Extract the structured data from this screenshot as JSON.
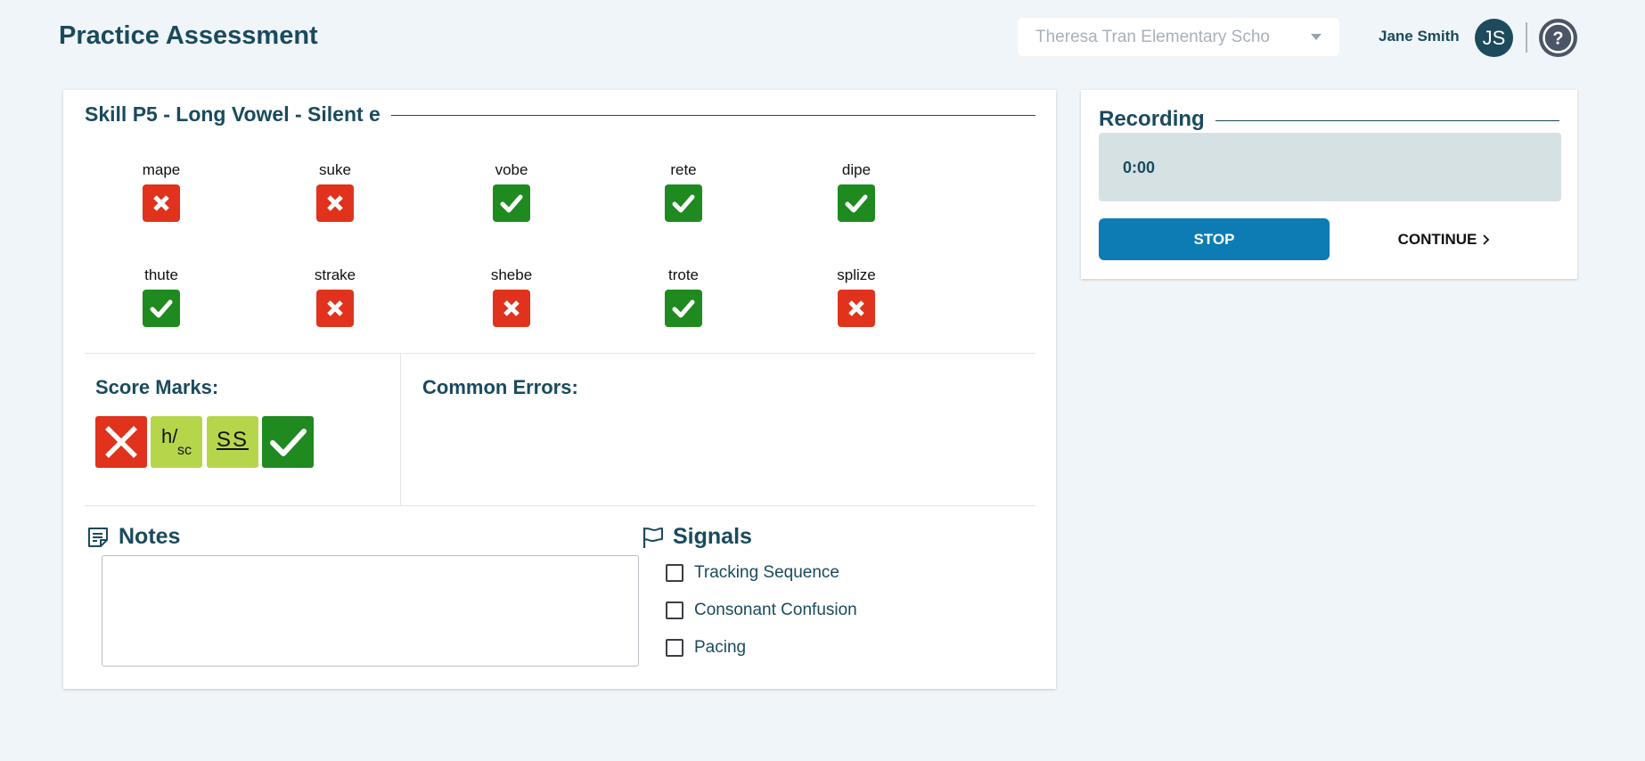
{
  "header": {
    "title": "Practice Assessment",
    "school_selected": "Theresa Tran Elementary Scho",
    "user_name": "Jane Smith",
    "user_initials": "JS",
    "help_symbol": "?"
  },
  "skill": {
    "title": "Skill P5 - Long Vowel - Silent e",
    "words": [
      {
        "word": "mape",
        "mark": "incorrect"
      },
      {
        "word": "suke",
        "mark": "incorrect"
      },
      {
        "word": "vobe",
        "mark": "correct"
      },
      {
        "word": "rete",
        "mark": "correct"
      },
      {
        "word": "dipe",
        "mark": "correct"
      },
      {
        "word": "thute",
        "mark": "correct"
      },
      {
        "word": "strake",
        "mark": "incorrect"
      },
      {
        "word": "shebe",
        "mark": "incorrect"
      },
      {
        "word": "trote",
        "mark": "correct"
      },
      {
        "word": "splize",
        "mark": "incorrect"
      }
    ]
  },
  "score_marks": {
    "label": "Score Marks:",
    "marks": [
      {
        "name": "incorrect",
        "icon": "x-icon"
      },
      {
        "name": "h/sc",
        "text_top": "h/",
        "text_sub": "sc"
      },
      {
        "name": "ss",
        "text": "SS"
      },
      {
        "name": "correct",
        "icon": "check-icon"
      }
    ]
  },
  "common_errors": {
    "label": "Common Errors:"
  },
  "notes": {
    "label": "Notes",
    "value": ""
  },
  "signals": {
    "label": "Signals",
    "items": [
      {
        "label": "Tracking Sequence",
        "checked": false
      },
      {
        "label": "Consonant Confusion",
        "checked": false
      },
      {
        "label": "Pacing",
        "checked": false
      }
    ]
  },
  "recording": {
    "title": "Recording",
    "time": "0:00",
    "stop_label": "STOP",
    "continue_label": "CONTINUE"
  },
  "colors": {
    "incorrect": "#e0321c",
    "correct": "#1f8a1f",
    "partial": "#b5d64a",
    "primary": "#0d7bb4",
    "text": "#1a4a5e"
  }
}
